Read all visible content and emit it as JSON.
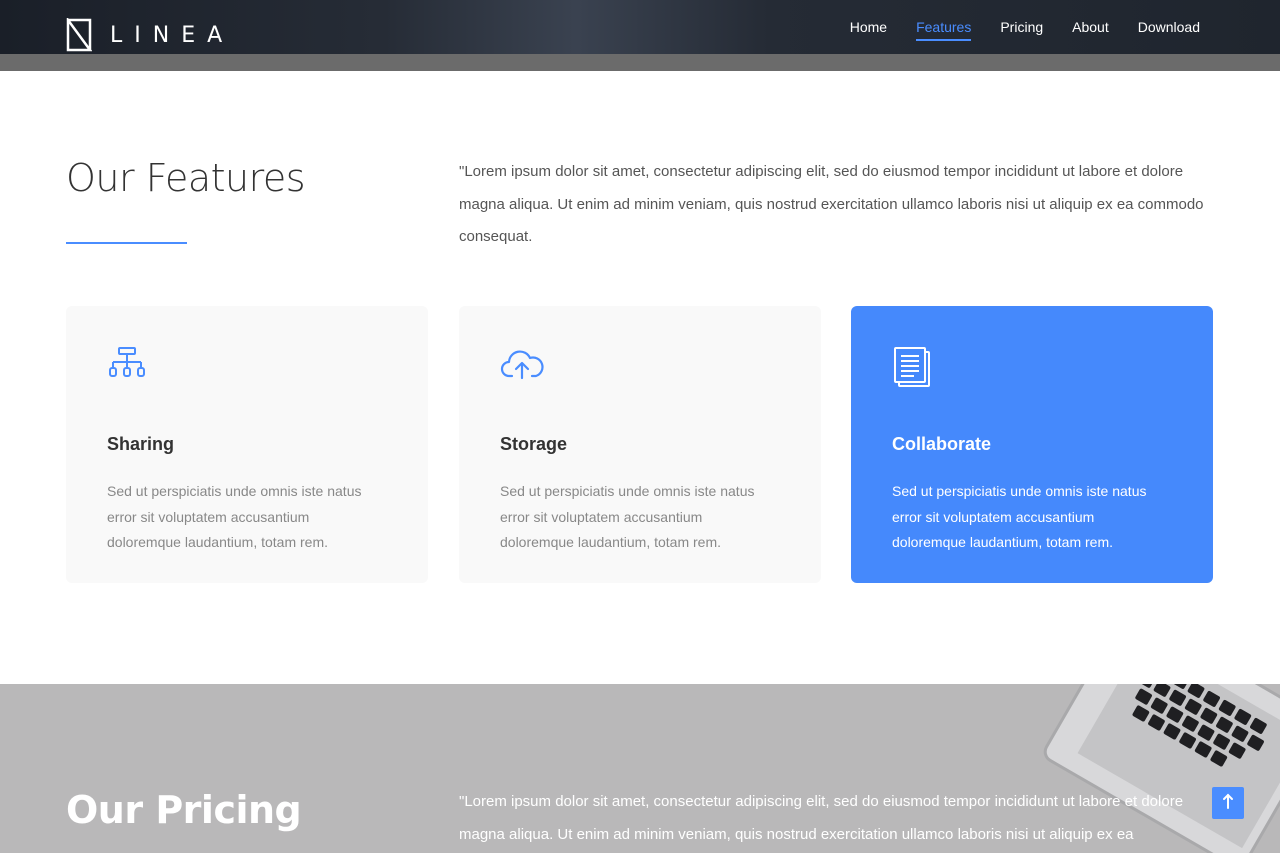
{
  "brand": {
    "name": "LINEA",
    "logo_icon": "linea-logo-icon",
    "accent": "#4a8dff"
  },
  "nav": {
    "items": [
      {
        "label": "Home",
        "active": false
      },
      {
        "label": "Features",
        "active": true
      },
      {
        "label": "Pricing",
        "active": false
      },
      {
        "label": "About",
        "active": false
      },
      {
        "label": "Download",
        "active": false
      }
    ]
  },
  "features": {
    "title": "Our Features",
    "description": "\"Lorem ipsum dolor sit amet, consectetur adipiscing elit, sed do eiusmod tempor incididunt ut labore et dolore magna aliqua. Ut enim ad minim veniam, quis nostrud exercitation ullamco laboris nisi ut aliquip ex ea commodo consequat.",
    "cards": [
      {
        "icon": "sitemap-icon",
        "title": "Sharing",
        "text": "Sed ut perspiciatis unde omnis iste natus error sit voluptatem accusantium doloremque laudantium, totam rem.",
        "highlighted": false
      },
      {
        "icon": "cloud-upload-icon",
        "title": "Storage",
        "text": "Sed ut perspiciatis unde omnis iste natus error sit voluptatem accusantium doloremque laudantium, totam rem.",
        "highlighted": false
      },
      {
        "icon": "document-icon",
        "title": "Collaborate",
        "text": "Sed ut perspiciatis unde omnis iste natus error sit voluptatem accusantium doloremque laudantium, totam rem.",
        "highlighted": true
      }
    ]
  },
  "pricing": {
    "title": "Our Pricing",
    "description": "\"Lorem ipsum dolor sit amet, consectetur adipiscing elit, sed do eiusmod tempor incididunt ut labore et dolore magna aliqua. Ut enim ad minim veniam, quis nostrud exercitation ullamco laboris nisi ut aliquip ex ea"
  },
  "scroll_top": {
    "icon": "arrow-up-icon",
    "glyph": "↑"
  },
  "colors": {
    "card_bg": "#f9f9f9",
    "card_highlight": "#4589fc",
    "pricing_bg": "#b9b8b9"
  }
}
